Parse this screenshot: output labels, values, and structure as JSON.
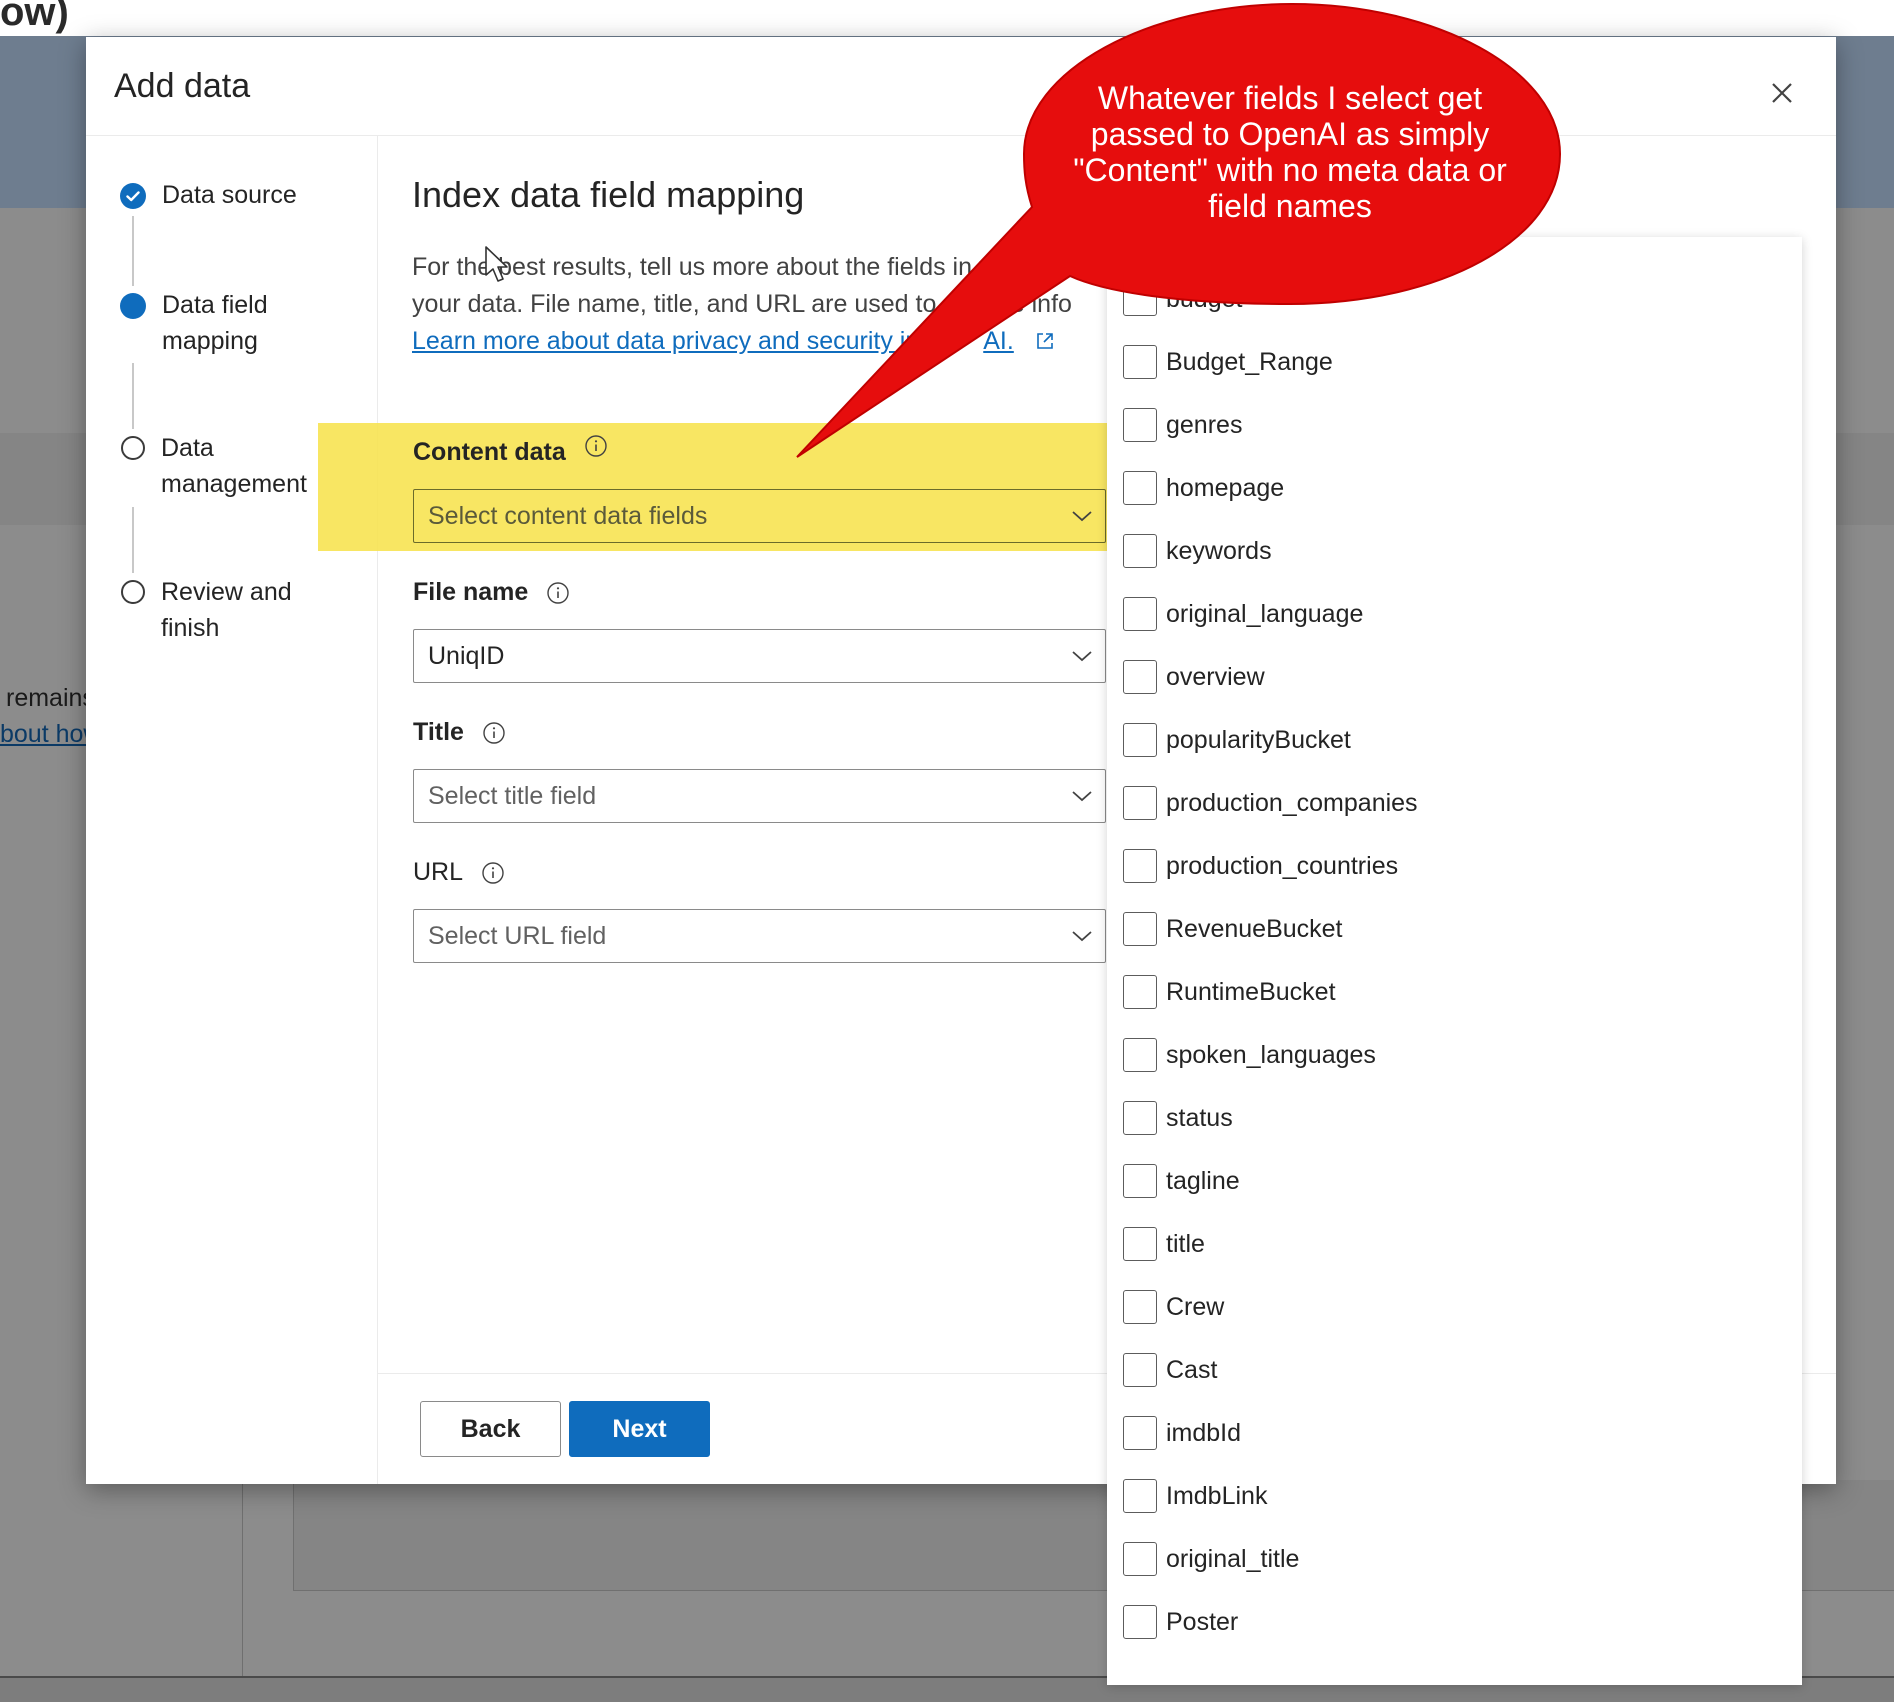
{
  "background": {
    "top_fragment": "ow)",
    "text_remains": "remains",
    "text_link": "bout how"
  },
  "modal": {
    "title": "Add data",
    "close_label": "Close"
  },
  "stepper": {
    "steps": [
      {
        "label": "Data source",
        "state": "completed"
      },
      {
        "label": "Data field mapping",
        "line1": "Data field",
        "line2": "mapping",
        "state": "current"
      },
      {
        "label": "Data management",
        "line1": "Data",
        "line2": "management",
        "state": "pending"
      },
      {
        "label": "Review and finish",
        "line1": "Review and",
        "line2": "finish",
        "state": "pending"
      }
    ]
  },
  "main": {
    "heading": "Index data field mapping",
    "description_line1": "For the best results, tell us more about the fields in y",
    "description_line2": "your data. File name, title, and URL are used to di",
    "description_line2_tail": "e info",
    "learn_more_link": "Learn more about data privacy and security in",
    "learn_more_tail": "AI.",
    "fields": {
      "content_data": {
        "label": "Content data",
        "placeholder": "Select content data fields"
      },
      "file_name": {
        "label": "File name",
        "value": "UniqID"
      },
      "title": {
        "label": "Title",
        "placeholder": "Select title field"
      },
      "url": {
        "label": "URL",
        "placeholder": "Select URL field"
      }
    }
  },
  "footer": {
    "back_label": "Back",
    "next_label": "Next"
  },
  "options": [
    {
      "label": "budget",
      "checked": false
    },
    {
      "label": "Budget_Range",
      "checked": false
    },
    {
      "label": "genres",
      "checked": false
    },
    {
      "label": "homepage",
      "checked": false
    },
    {
      "label": "keywords",
      "checked": false
    },
    {
      "label": "original_language",
      "checked": false
    },
    {
      "label": "overview",
      "checked": false
    },
    {
      "label": "popularityBucket",
      "checked": false
    },
    {
      "label": "production_companies",
      "checked": false
    },
    {
      "label": "production_countries",
      "checked": false
    },
    {
      "label": "RevenueBucket",
      "checked": false
    },
    {
      "label": "RuntimeBucket",
      "checked": false
    },
    {
      "label": "spoken_languages",
      "checked": false
    },
    {
      "label": "status",
      "checked": false
    },
    {
      "label": "tagline",
      "checked": false
    },
    {
      "label": "title",
      "checked": false
    },
    {
      "label": "Crew",
      "checked": false
    },
    {
      "label": "Cast",
      "checked": false
    },
    {
      "label": "imdbId",
      "checked": false
    },
    {
      "label": "ImdbLink",
      "checked": false
    },
    {
      "label": "original_title",
      "checked": false
    },
    {
      "label": "Poster",
      "checked": false
    }
  ],
  "callout": {
    "line1": "Whatever fields I select get",
    "line2": "passed to OpenAI as simply",
    "line3": "\"Content\" with no meta data or",
    "line4": "field names",
    "color": "#e60d0d"
  },
  "colors": {
    "accent": "#0f6cbd",
    "highlight": "#f7e34d"
  }
}
